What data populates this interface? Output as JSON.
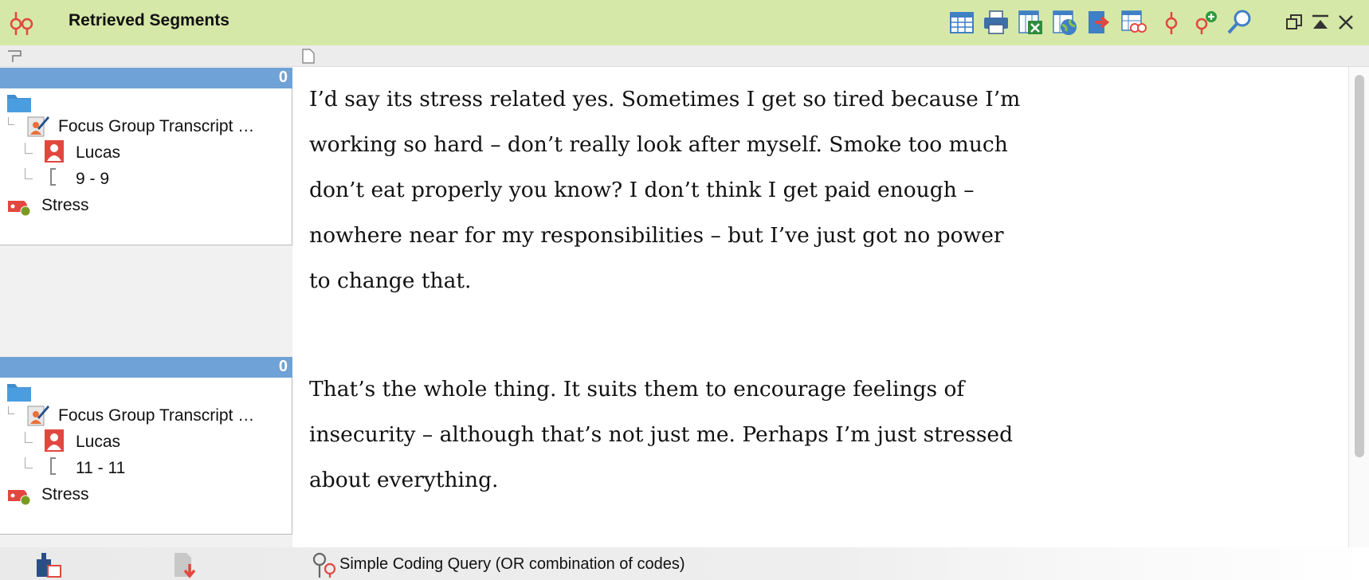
{
  "window": {
    "title": "Retrieved Segments"
  },
  "toolbar": {
    "icons": [
      "table-view-icon",
      "print-icon",
      "excel-export-icon",
      "web-export-icon",
      "export-arrow-icon",
      "table-code-icon",
      "code-pin-icon",
      "code-add-icon",
      "search-icon"
    ]
  },
  "window_controls": [
    "restore-icon",
    "collapse-icon",
    "close-icon"
  ],
  "left_panel": {
    "segments": [
      {
        "count": "0",
        "document": "Focus Group Transcript …",
        "speaker": "Lucas",
        "range": "9 - 9",
        "code": "Stress"
      },
      {
        "count": "0",
        "document": "Focus Group Transcript …",
        "speaker": "Lucas",
        "range": "11 - 11",
        "code": "Stress"
      }
    ]
  },
  "text_panel": {
    "paragraphs": [
      [
        "I’d say its stress related yes.  Sometimes I get so tired because I’m",
        "working so hard – don’t really look after myself.  Smoke too much",
        "don’t eat properly you know? I don’t think I get paid enough –",
        "nowhere near for my responsibilities – but I’ve just got no power",
        "to change that."
      ],
      [
        "That’s the whole thing.  It suits them to encourage feelings of",
        "insecurity – although that’s not just me.  Perhaps I’m just stressed",
        "about everything."
      ]
    ]
  },
  "status_bar": {
    "query_text": "Simple Coding Query (OR combination of codes)"
  },
  "colors": {
    "titlebar": "#d6e8a8",
    "segment_bar": "#6fa2d6",
    "code_red": "#e2473f",
    "folder_blue": "#3f8fd2"
  }
}
